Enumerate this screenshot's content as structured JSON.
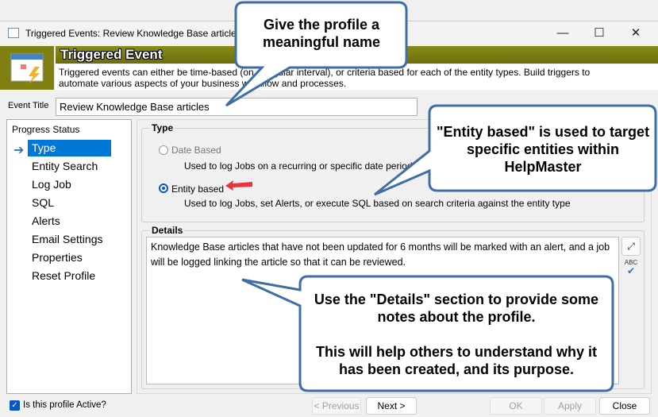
{
  "window": {
    "title": "Triggered Events: Review Knowledge Base articles",
    "minimize": "—",
    "maximize": "☐",
    "close": "✕"
  },
  "header": {
    "title": "Triggered Event",
    "description_line1": "Triggered events can either be time-based (on a regular interval), or criteria based for each of the entity types.  Build triggers to",
    "description_line2": "automate various aspects of your business workflow and processes."
  },
  "event_title": {
    "label": "Event Title",
    "value": "Review Knowledge Base articles"
  },
  "progress": {
    "header": "Progress Status",
    "items": [
      "Type",
      "Entity Search",
      "Log Job",
      "SQL",
      "Alerts",
      "Email Settings",
      "Properties",
      "Reset Profile"
    ],
    "selected": 0
  },
  "type_group": {
    "label": "Type",
    "options": [
      {
        "label": "Date Based",
        "desc": "Used to log Jobs on a recurring or specific date period",
        "selected": false,
        "enabled": false
      },
      {
        "label": "Entity based",
        "desc": "Used to log Jobs, set Alerts, or execute SQL based on search criteria against the entity type",
        "selected": true,
        "enabled": true
      }
    ]
  },
  "details": {
    "label": "Details",
    "text": "Knowledge Base articles that have not been updated for 6 months will be marked with an alert, and a job will be logged linking the article so that it can be reviewed.",
    "expand_icon": "expand-icon",
    "spellcheck_label": "ABC"
  },
  "footer": {
    "active_label": "Is this profile Active?",
    "active": true,
    "previous": "< Previous",
    "next": "Next >",
    "ok": "OK",
    "apply": "Apply",
    "close": "Close"
  },
  "callouts": {
    "name": "Give the profile a meaningful name",
    "entity": "\"Entity based\" is used to target specific entities within HelpMaster",
    "details_1": "Use the \"Details\" section to provide some notes about the profile.",
    "details_2": "This will help others to understand why it has been created, and its purpose."
  },
  "colors": {
    "accent": "#0078d7",
    "header_olive": "#7f7f12",
    "callout_border": "#3d6ea5",
    "arrow_red": "#e8343a"
  }
}
